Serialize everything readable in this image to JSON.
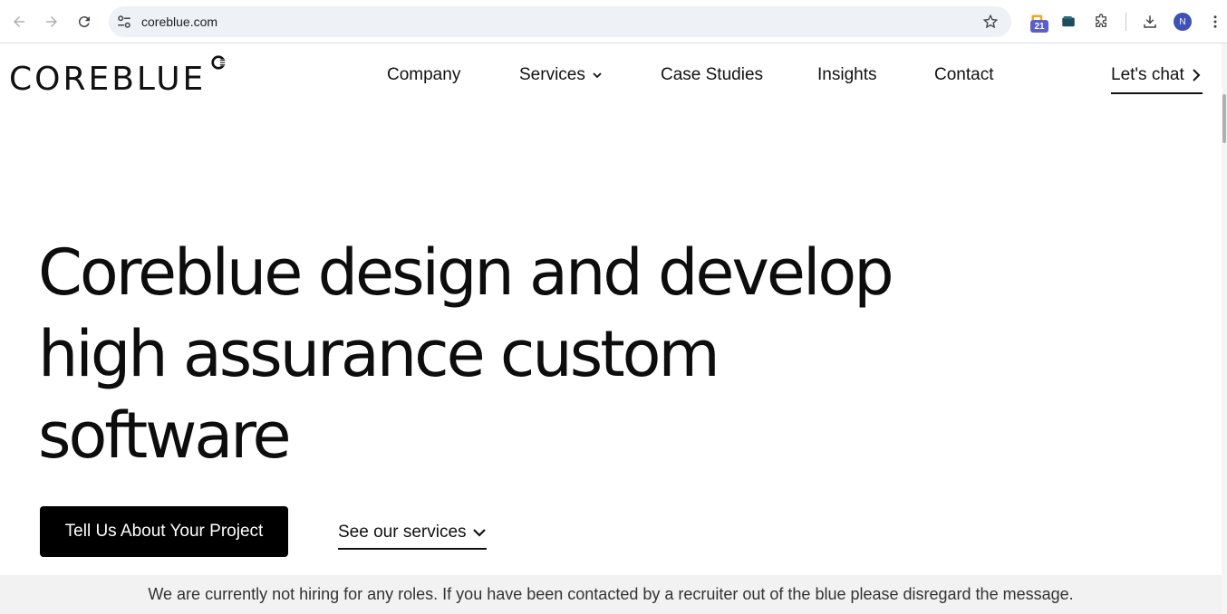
{
  "browser": {
    "url": "coreblue.com",
    "extension_badge": "21",
    "profile_initial": "N"
  },
  "site": {
    "logo_text": "COREBLUE",
    "nav": {
      "company": "Company",
      "services": "Services",
      "case_studies": "Case Studies",
      "insights": "Insights",
      "contact": "Contact",
      "cta": "Let's chat"
    }
  },
  "hero": {
    "title": "Coreblue design and develop high assurance custom software",
    "primary_button": "Tell Us About Your Project",
    "secondary_link": "See our services"
  },
  "notice": {
    "text": "We are currently not hiring for any roles. If you have been contacted by a recruiter out of the blue please disregard the message."
  },
  "colors": {
    "background": "#ffffff",
    "text": "#111111",
    "button": "#000000",
    "notice_bg": "#f2f2f2",
    "omnibox": "#eef1f6"
  }
}
